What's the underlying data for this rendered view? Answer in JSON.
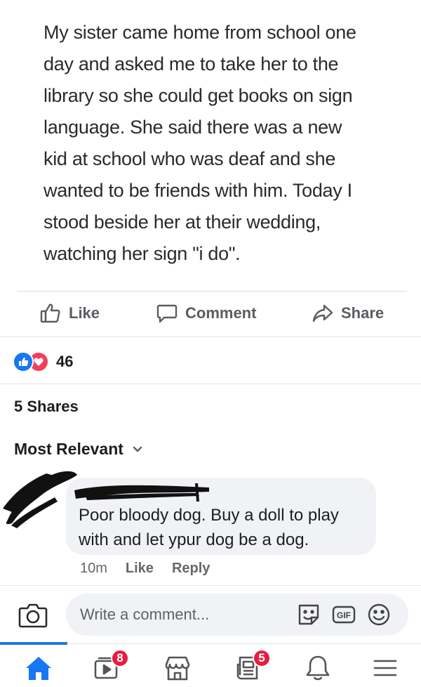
{
  "post": {
    "lines": [
      "My sister came home from school one",
      "day and asked me to take her to the",
      "library so she could get books on sign",
      "language. She said there was a new",
      "kid at school who was deaf and she",
      "wanted to be friends with him. Today I",
      "stood beside her at their wedding,",
      "watching her sign \"i do\"."
    ]
  },
  "actions": {
    "like": "Like",
    "comment": "Comment",
    "share": "Share"
  },
  "reactions": {
    "count": "46",
    "icons": [
      "like-reaction-icon",
      "love-reaction-icon"
    ]
  },
  "shares": "5 Shares",
  "sort": {
    "label": "Most Relevant"
  },
  "comment": {
    "lines": [
      "Poor bloody dog. Buy a doll to play",
      "with and let ypur dog be a dog."
    ],
    "time": "10m",
    "like": "Like",
    "reply": "Reply"
  },
  "composer": {
    "placeholder": "Write a comment...",
    "gif": "GIF"
  },
  "tabs": {
    "items": [
      "home-icon",
      "video-icon",
      "marketplace-icon",
      "news-icon",
      "bell-icon",
      "menu-icon"
    ],
    "video_badge": "8",
    "news_badge": "5"
  },
  "colors": {
    "accent": "#1877f2",
    "love": "#f33e58",
    "badge": "#e41e3f",
    "bubble": "#f0f2f5"
  }
}
